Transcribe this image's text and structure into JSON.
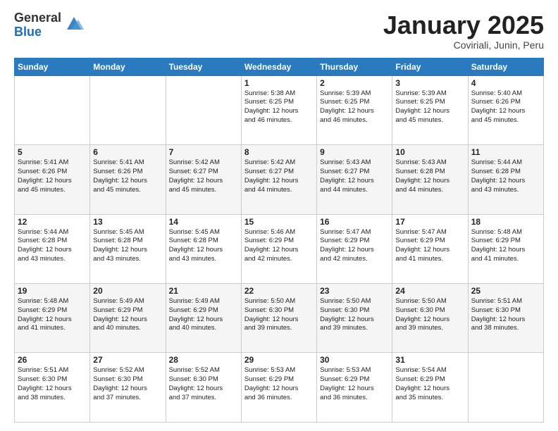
{
  "header": {
    "logo_general": "General",
    "logo_blue": "Blue",
    "month_title": "January 2025",
    "subtitle": "Coviriali, Junin, Peru"
  },
  "days_of_week": [
    "Sunday",
    "Monday",
    "Tuesday",
    "Wednesday",
    "Thursday",
    "Friday",
    "Saturday"
  ],
  "weeks": [
    [
      {
        "day": "",
        "info": ""
      },
      {
        "day": "",
        "info": ""
      },
      {
        "day": "",
        "info": ""
      },
      {
        "day": "1",
        "info": "Sunrise: 5:38 AM\nSunset: 6:25 PM\nDaylight: 12 hours\nand 46 minutes."
      },
      {
        "day": "2",
        "info": "Sunrise: 5:39 AM\nSunset: 6:25 PM\nDaylight: 12 hours\nand 46 minutes."
      },
      {
        "day": "3",
        "info": "Sunrise: 5:39 AM\nSunset: 6:25 PM\nDaylight: 12 hours\nand 45 minutes."
      },
      {
        "day": "4",
        "info": "Sunrise: 5:40 AM\nSunset: 6:26 PM\nDaylight: 12 hours\nand 45 minutes."
      }
    ],
    [
      {
        "day": "5",
        "info": "Sunrise: 5:41 AM\nSunset: 6:26 PM\nDaylight: 12 hours\nand 45 minutes."
      },
      {
        "day": "6",
        "info": "Sunrise: 5:41 AM\nSunset: 6:26 PM\nDaylight: 12 hours\nand 45 minutes."
      },
      {
        "day": "7",
        "info": "Sunrise: 5:42 AM\nSunset: 6:27 PM\nDaylight: 12 hours\nand 45 minutes."
      },
      {
        "day": "8",
        "info": "Sunrise: 5:42 AM\nSunset: 6:27 PM\nDaylight: 12 hours\nand 44 minutes."
      },
      {
        "day": "9",
        "info": "Sunrise: 5:43 AM\nSunset: 6:27 PM\nDaylight: 12 hours\nand 44 minutes."
      },
      {
        "day": "10",
        "info": "Sunrise: 5:43 AM\nSunset: 6:28 PM\nDaylight: 12 hours\nand 44 minutes."
      },
      {
        "day": "11",
        "info": "Sunrise: 5:44 AM\nSunset: 6:28 PM\nDaylight: 12 hours\nand 43 minutes."
      }
    ],
    [
      {
        "day": "12",
        "info": "Sunrise: 5:44 AM\nSunset: 6:28 PM\nDaylight: 12 hours\nand 43 minutes."
      },
      {
        "day": "13",
        "info": "Sunrise: 5:45 AM\nSunset: 6:28 PM\nDaylight: 12 hours\nand 43 minutes."
      },
      {
        "day": "14",
        "info": "Sunrise: 5:45 AM\nSunset: 6:28 PM\nDaylight: 12 hours\nand 43 minutes."
      },
      {
        "day": "15",
        "info": "Sunrise: 5:46 AM\nSunset: 6:29 PM\nDaylight: 12 hours\nand 42 minutes."
      },
      {
        "day": "16",
        "info": "Sunrise: 5:47 AM\nSunset: 6:29 PM\nDaylight: 12 hours\nand 42 minutes."
      },
      {
        "day": "17",
        "info": "Sunrise: 5:47 AM\nSunset: 6:29 PM\nDaylight: 12 hours\nand 41 minutes."
      },
      {
        "day": "18",
        "info": "Sunrise: 5:48 AM\nSunset: 6:29 PM\nDaylight: 12 hours\nand 41 minutes."
      }
    ],
    [
      {
        "day": "19",
        "info": "Sunrise: 5:48 AM\nSunset: 6:29 PM\nDaylight: 12 hours\nand 41 minutes."
      },
      {
        "day": "20",
        "info": "Sunrise: 5:49 AM\nSunset: 6:29 PM\nDaylight: 12 hours\nand 40 minutes."
      },
      {
        "day": "21",
        "info": "Sunrise: 5:49 AM\nSunset: 6:29 PM\nDaylight: 12 hours\nand 40 minutes."
      },
      {
        "day": "22",
        "info": "Sunrise: 5:50 AM\nSunset: 6:30 PM\nDaylight: 12 hours\nand 39 minutes."
      },
      {
        "day": "23",
        "info": "Sunrise: 5:50 AM\nSunset: 6:30 PM\nDaylight: 12 hours\nand 39 minutes."
      },
      {
        "day": "24",
        "info": "Sunrise: 5:50 AM\nSunset: 6:30 PM\nDaylight: 12 hours\nand 39 minutes."
      },
      {
        "day": "25",
        "info": "Sunrise: 5:51 AM\nSunset: 6:30 PM\nDaylight: 12 hours\nand 38 minutes."
      }
    ],
    [
      {
        "day": "26",
        "info": "Sunrise: 5:51 AM\nSunset: 6:30 PM\nDaylight: 12 hours\nand 38 minutes."
      },
      {
        "day": "27",
        "info": "Sunrise: 5:52 AM\nSunset: 6:30 PM\nDaylight: 12 hours\nand 37 minutes."
      },
      {
        "day": "28",
        "info": "Sunrise: 5:52 AM\nSunset: 6:30 PM\nDaylight: 12 hours\nand 37 minutes."
      },
      {
        "day": "29",
        "info": "Sunrise: 5:53 AM\nSunset: 6:29 PM\nDaylight: 12 hours\nand 36 minutes."
      },
      {
        "day": "30",
        "info": "Sunrise: 5:53 AM\nSunset: 6:29 PM\nDaylight: 12 hours\nand 36 minutes."
      },
      {
        "day": "31",
        "info": "Sunrise: 5:54 AM\nSunset: 6:29 PM\nDaylight: 12 hours\nand 35 minutes."
      },
      {
        "day": "",
        "info": ""
      }
    ]
  ]
}
